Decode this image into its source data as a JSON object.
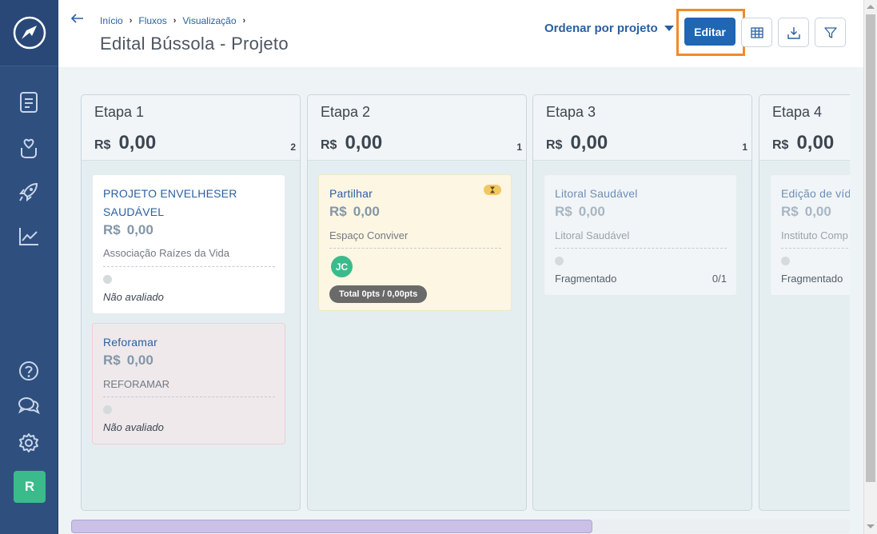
{
  "sidebar": {
    "logo_icon": "compass-logo-icon",
    "top_icons": [
      "document-icon",
      "hand-heart-icon",
      "rocket-icon",
      "chart-line-icon"
    ],
    "bottom_icons": [
      "help-icon",
      "chat-icon",
      "settings-icon"
    ],
    "user_avatar": "R"
  },
  "header": {
    "breadcrumb": [
      "Início",
      "Fluxos",
      "Visualização"
    ],
    "title": "Edital Bússola - Projeto",
    "sort_label": "Ordenar por projeto",
    "edit_label": "Editar",
    "tool_icons": [
      "table-icon",
      "download-icon",
      "filter-icon"
    ],
    "accent_color": "#1f66b3",
    "highlight_color": "#f08a2c"
  },
  "columns": [
    {
      "title": "Etapa 1",
      "currency": "R$",
      "amount": "0,00",
      "count": "2",
      "cards": [
        {
          "title": "PROJETO ENVELHESER SAUDÁVEL",
          "currency": "R$",
          "value": "0,00",
          "org": "Associação Raízes da Vida",
          "status": "Não avaliado"
        },
        {
          "title": "Reforamar",
          "currency": "R$",
          "value": "0,00",
          "org": "REFORAMAR",
          "status": "Não avaliado"
        }
      ]
    },
    {
      "title": "Etapa 2",
      "currency": "R$",
      "amount": "0,00",
      "count": "1",
      "cards": [
        {
          "title": "Partilhar",
          "currency": "R$",
          "value": "0,00",
          "org": "Espaço Conviver",
          "avatar": "JC",
          "score": "Total 0pts / 0,00pts"
        }
      ]
    },
    {
      "title": "Etapa 3",
      "currency": "R$",
      "amount": "0,00",
      "count": "1",
      "cards": [
        {
          "title": "Litoral Saudável",
          "currency": "R$",
          "value": "0,00",
          "org": "Litoral Saudável",
          "status": "Fragmentado",
          "progress": "0/1"
        }
      ]
    },
    {
      "title": "Etapa 4",
      "currency": "R$",
      "amount": "0,00",
      "cards": [
        {
          "title": "Edição de víd",
          "currency": "R$",
          "value": "0,00",
          "org": "Instituto Comp",
          "status": "Fragmentado"
        }
      ]
    }
  ]
}
